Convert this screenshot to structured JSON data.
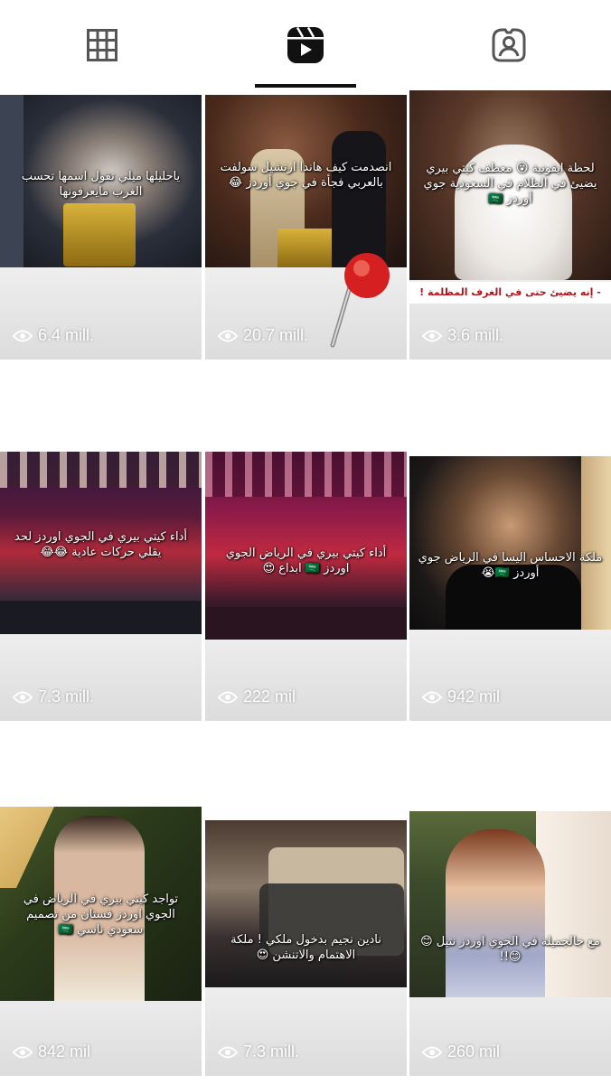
{
  "tabs": [
    {
      "name": "posts",
      "icon": "grid-icon"
    },
    {
      "name": "reels",
      "icon": "reels-icon",
      "active": true
    },
    {
      "name": "tagged",
      "icon": "tagged-person-icon"
    }
  ],
  "colors": {
    "active_tab": "#111111",
    "icon": "#555555",
    "pin_red": "#d42020",
    "banner_text": "#b0141b"
  },
  "posts": [
    {
      "caption": "ياحليلها ميلي تقول اسمها تحسب الغرب مايعرفونها",
      "views": "6.4 mill."
    },
    {
      "caption": "انصدمت كيف هاندا ارتشيل سولفت بالعربي فجأة في جوي أوردز 😂",
      "views": "20.7 mill."
    },
    {
      "caption": "لحظة ايقونية 😮 معطف كيتي بيري يضيئ في الظلام في السعودية جوي أوردز 🇸🇦",
      "views": "3.6 mill.",
      "banner": "- إنه يضيئ حتى في الغرف المظلمة !"
    },
    {
      "caption": "أداء كيتي بيري في الجوي اوردز لحد يقلي حركات عادية 😂😂",
      "views": "7.3 mill."
    },
    {
      "caption": "أداء كيتي بيري في الرياض الجوي اوردز 🇸🇦 ابداع 😍",
      "views": "222 mil"
    },
    {
      "caption": "ملكة الاحساس اليسا في الرياض جوي أوردز 🇸🇦😭",
      "views": "942 mil"
    },
    {
      "caption": "تواجد كيتي بيري في الرياض في الجوي اوردز فستان من تصميم سعودي ناسي 🇸🇦",
      "views": "842 mil"
    },
    {
      "caption": "نادين نجيم بدخول ملكي ! ملكة الاهتمام والاتنشن 😍",
      "views": "7.3 mill."
    },
    {
      "caption": "مع جالجميلة في الجوي اوردز نتيل 😊😊!!",
      "views": "260 mil"
    }
  ]
}
